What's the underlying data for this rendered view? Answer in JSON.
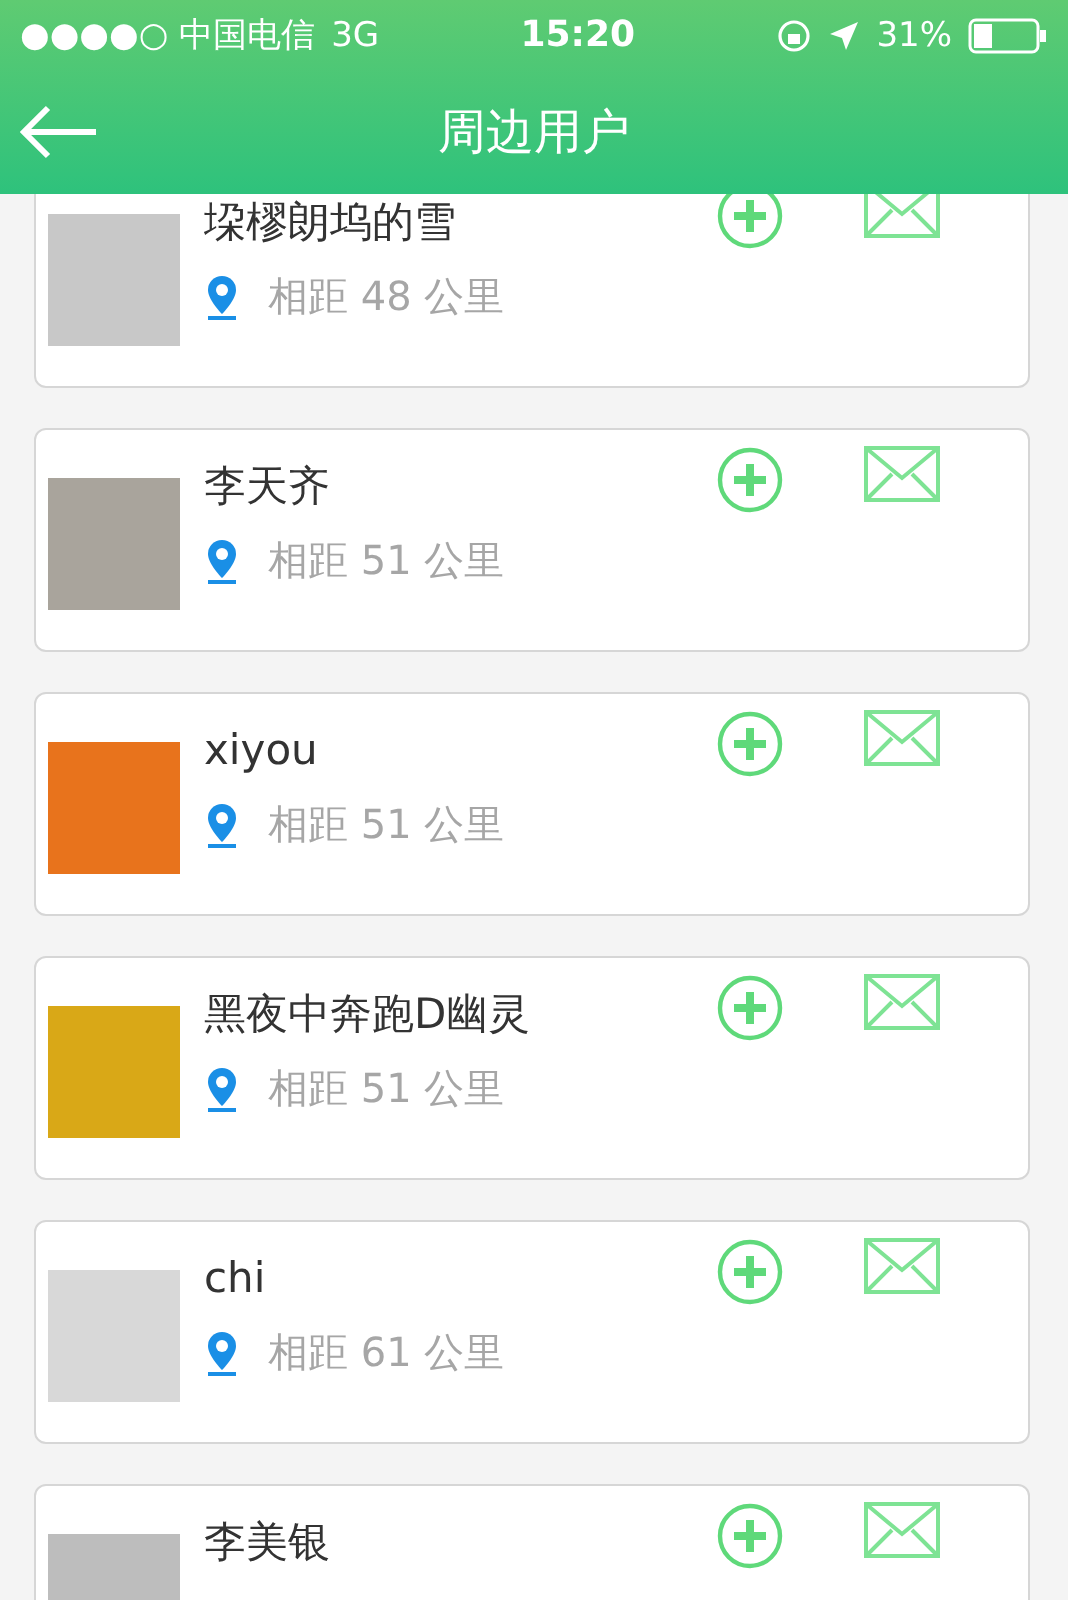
{
  "status_bar": {
    "carrier": "●●●●○ 中国电信",
    "network": "3G",
    "time": "15:20",
    "battery": "31%"
  },
  "nav": {
    "title": "周边用户"
  },
  "users": [
    {
      "name": "垜樛朗坞的雪",
      "distance": "相距 48 公里"
    },
    {
      "name": "李天齐",
      "distance": "相距 51 公里"
    },
    {
      "name": "xiyou",
      "distance": "相距 51 公里"
    },
    {
      "name": "黑夜中奔跑D幽灵",
      "distance": "相距 51 公里"
    },
    {
      "name": "chi",
      "distance": "相距 61 公里"
    },
    {
      "name": "李美银"
    }
  ]
}
